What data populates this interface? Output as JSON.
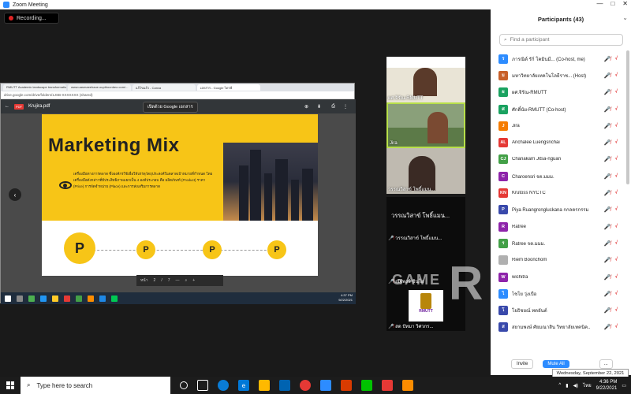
{
  "window": {
    "title": "Zoom Meeting",
    "min": "—",
    "max": "□",
    "close": "✕"
  },
  "recording": {
    "label": "Recording..."
  },
  "share": {
    "tabs": [
      "RMUTT Academic landscape transformation...",
      "www.uasmaeehaoe.oupthoonbeo.com/...",
      "แก้ไขแล้ว - Canva",
      "เอกสาร - Google ไดรฟ์"
    ],
    "url": "drive.google.com/drive/folders/1JSB-XXXXXXX (shared)",
    "pdf_name": "Krujira.pdf",
    "pdf_badge": "PDF",
    "open_with": "เปิดด้วย Google เอกสาร",
    "slide": {
      "title": "Marketing Mix",
      "body": "เครื่องมือทางการตลาด ซึ่งองค์กรใช้เพื่อให้บรรลุวัตถุประสงค์ในตลาดเป้าหมายที่กำหนด โดยเครื่องมือดังกล่าวที่มีประสิทธิภาพแยกเป็น 4 องค์ประกอบ คือ ผลิตภัณฑ์ (Product) ราคา (Price) การจัดจำหน่าย (Place) และการส่งเสริมการตลาด",
      "p_labels": [
        "P",
        "P",
        "P",
        "P"
      ]
    },
    "pager": {
      "page_label": "หน้า",
      "current": "2",
      "sep": "/",
      "total": "7",
      "minus": "—",
      "plus": "+"
    },
    "inner_clock": {
      "time": "4:37 PM",
      "date": "9/22/2021"
    }
  },
  "videos": [
    {
      "name": "ผศ.จิรัณ-RMUTT"
    },
    {
      "name": "Jira"
    },
    {
      "name": "วรรณวิสาข์ โพธิ์แมน..."
    },
    {
      "name": "ณัฐพงษ์ ชินโอ"
    },
    {
      "name": "สด ปัทมา วิศวกร..."
    }
  ],
  "video_caption": "วรรณวิสาข์ โพธิ์แมน...",
  "video_sublabel": "RMUTT",
  "participants": {
    "title": "Participants (43)",
    "search_placeholder": "Find a participant",
    "items": [
      {
        "initials": "ร",
        "name": "ภารณิต์ รัก์ โคมินมี... (Co-host, me)",
        "color": "#2d8cff"
      },
      {
        "initials": "ม",
        "name": "มหาวิทยาลัยเทคโนโลยีราช... (Host)",
        "color": "#c8602a"
      },
      {
        "initials": "ผ",
        "name": "ผศ.จิรัณ-RMUTT",
        "color": "#1aa260"
      },
      {
        "initials": "ศ",
        "name": "ศักดิ์นัย-RMUTT (Co-host)",
        "color": "#1aa260"
      },
      {
        "initials": "J",
        "name": "Jira",
        "color": "#f57c00"
      },
      {
        "initials": "AL",
        "name": "Anchalee Luengsrichai",
        "color": "#e53935"
      },
      {
        "initials": "CJ",
        "name": "Chanakarn Jitsa-nguan",
        "color": "#43a047"
      },
      {
        "initials": "C",
        "name": "Charoensri จต.มมม.",
        "color": "#8e24aa"
      },
      {
        "initials": "KN",
        "name": "Krutoss NYCTC",
        "color": "#e53935"
      },
      {
        "initials": "P",
        "name": "Piya Ruangrongluckana กกลตรกรรม",
        "color": "#3949ab"
      },
      {
        "initials": "R",
        "name": "Ratree",
        "color": "#8e24aa"
      },
      {
        "initials": "ร",
        "name": "Ratree จต.มมม.",
        "color": "#43a047"
      },
      {
        "initials": "",
        "name": "Riem Boonchom",
        "color": "#b0b0b0"
      },
      {
        "initials": "W",
        "name": "wichitra",
        "color": "#8e24aa"
      },
      {
        "initials": "ไ",
        "name": "ไชโย วุ่งเบือ",
        "color": "#2d8cff"
      },
      {
        "initials": "โ",
        "name": "โยธิชยณ์ ทดยันต์",
        "color": "#3949ab"
      },
      {
        "initials": "ส",
        "name": "สยามพงษ์ ศัยมณาสิน วิทยาลัยเทคนิค...",
        "color": "#3949ab"
      }
    ],
    "invite": "Invite",
    "mute_all": "Mute All",
    "more": "..."
  },
  "date_tooltip": "Wednesday, September 22, 2021",
  "watermark": {
    "line1": "GAME",
    "line2": "R"
  },
  "taskbar": {
    "search_placeholder": "Type here to search",
    "lang": "ไทย",
    "time": "4:36 PM",
    "date": "9/22/2021"
  }
}
